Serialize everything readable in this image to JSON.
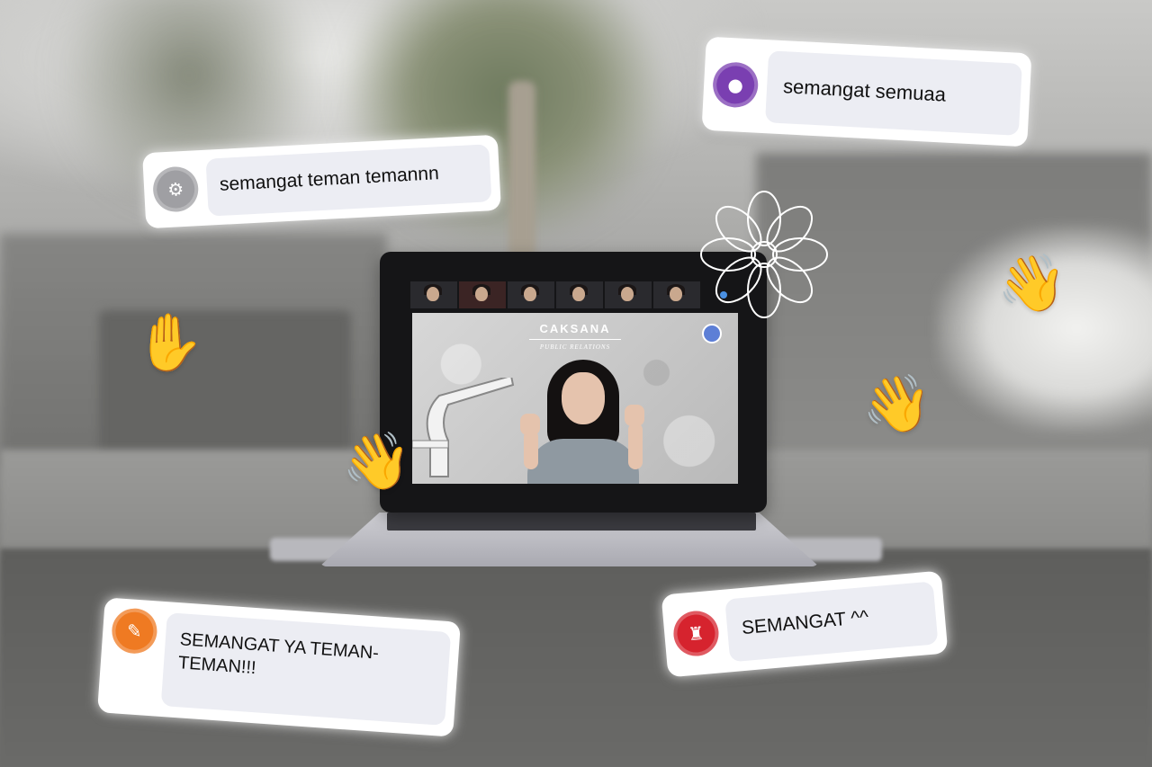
{
  "screen": {
    "title": "CAKSANA",
    "subtitle": "PUBLIC RELATIONS"
  },
  "comments": [
    {
      "avatar_icon": "badge-icon",
      "avatar_color": "#9f9fa3",
      "text": "semangat teman temannn"
    },
    {
      "avatar_icon": "badge-icon",
      "avatar_color": "#7a3fb1",
      "text": "semangat semuaa"
    },
    {
      "avatar_icon": "badge-icon",
      "avatar_color": "#ef7a22",
      "text": "SEMANGAT YA TEMAN-TEMAN!!!"
    },
    {
      "avatar_icon": "badge-icon",
      "avatar_color": "#d6232e",
      "text": "SEMANGAT ^^"
    }
  ],
  "decorations": {
    "wave_emoji": "👋",
    "raised_hand_emoji": "✋"
  }
}
